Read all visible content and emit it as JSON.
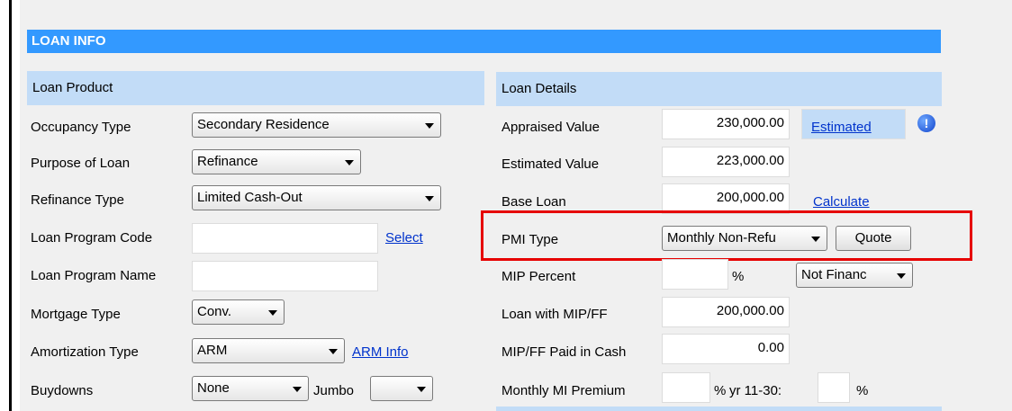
{
  "section": {
    "title": "LOAN INFO"
  },
  "loan_product": {
    "header": "Loan Product",
    "occupancy_type": {
      "label": "Occupancy Type",
      "value": "Secondary Residence"
    },
    "purpose_of_loan": {
      "label": "Purpose of Loan",
      "value": "Refinance"
    },
    "refinance_type": {
      "label": "Refinance Type",
      "value": "Limited Cash-Out"
    },
    "loan_program_code": {
      "label": "Loan Program Code",
      "value": "",
      "link": "Select"
    },
    "loan_program_name": {
      "label": "Loan Program Name",
      "value": ""
    },
    "mortgage_type": {
      "label": "Mortgage Type",
      "value": "Conv."
    },
    "amortization_type": {
      "label": "Amortization Type",
      "value": "ARM",
      "link": "ARM Info"
    },
    "buydowns": {
      "label": "Buydowns",
      "value": "None",
      "jumbo_label": "Jumbo",
      "jumbo_value": ""
    }
  },
  "loan_details": {
    "header": "Loan Details",
    "appraised_value": {
      "label": "Appraised Value",
      "value": "230,000.00",
      "link": "Estimated"
    },
    "estimated_value": {
      "label": "Estimated Value",
      "value": "223,000.00"
    },
    "base_loan": {
      "label": "Base Loan",
      "value": "200,000.00",
      "link": "Calculate"
    },
    "pmi_type": {
      "label": "PMI Type",
      "value": "Monthly Non-Refu",
      "button": "Quote"
    },
    "mip_percent": {
      "label": "MIP Percent",
      "value": "",
      "unit": "%",
      "financed": "Not Financ"
    },
    "loan_with_mip": {
      "label": "Loan with MIP/FF",
      "value": "200,000.00"
    },
    "mip_paid_cash": {
      "label": "MIP/FF Paid in Cash",
      "value": "0.00"
    },
    "monthly_mi_premium": {
      "label": "Monthly MI Premium",
      "value": "",
      "unit": "%",
      "yr_label": "yr 11-30:",
      "yr_value": "",
      "yr_unit": "%"
    }
  },
  "icons": {
    "info": "info-icon",
    "dropdown": "chevron-down-icon"
  },
  "colors": {
    "section_header": "#3399ff",
    "sub_header": "#c2dcf7",
    "highlight": "#e60000",
    "link": "#0033cc"
  }
}
